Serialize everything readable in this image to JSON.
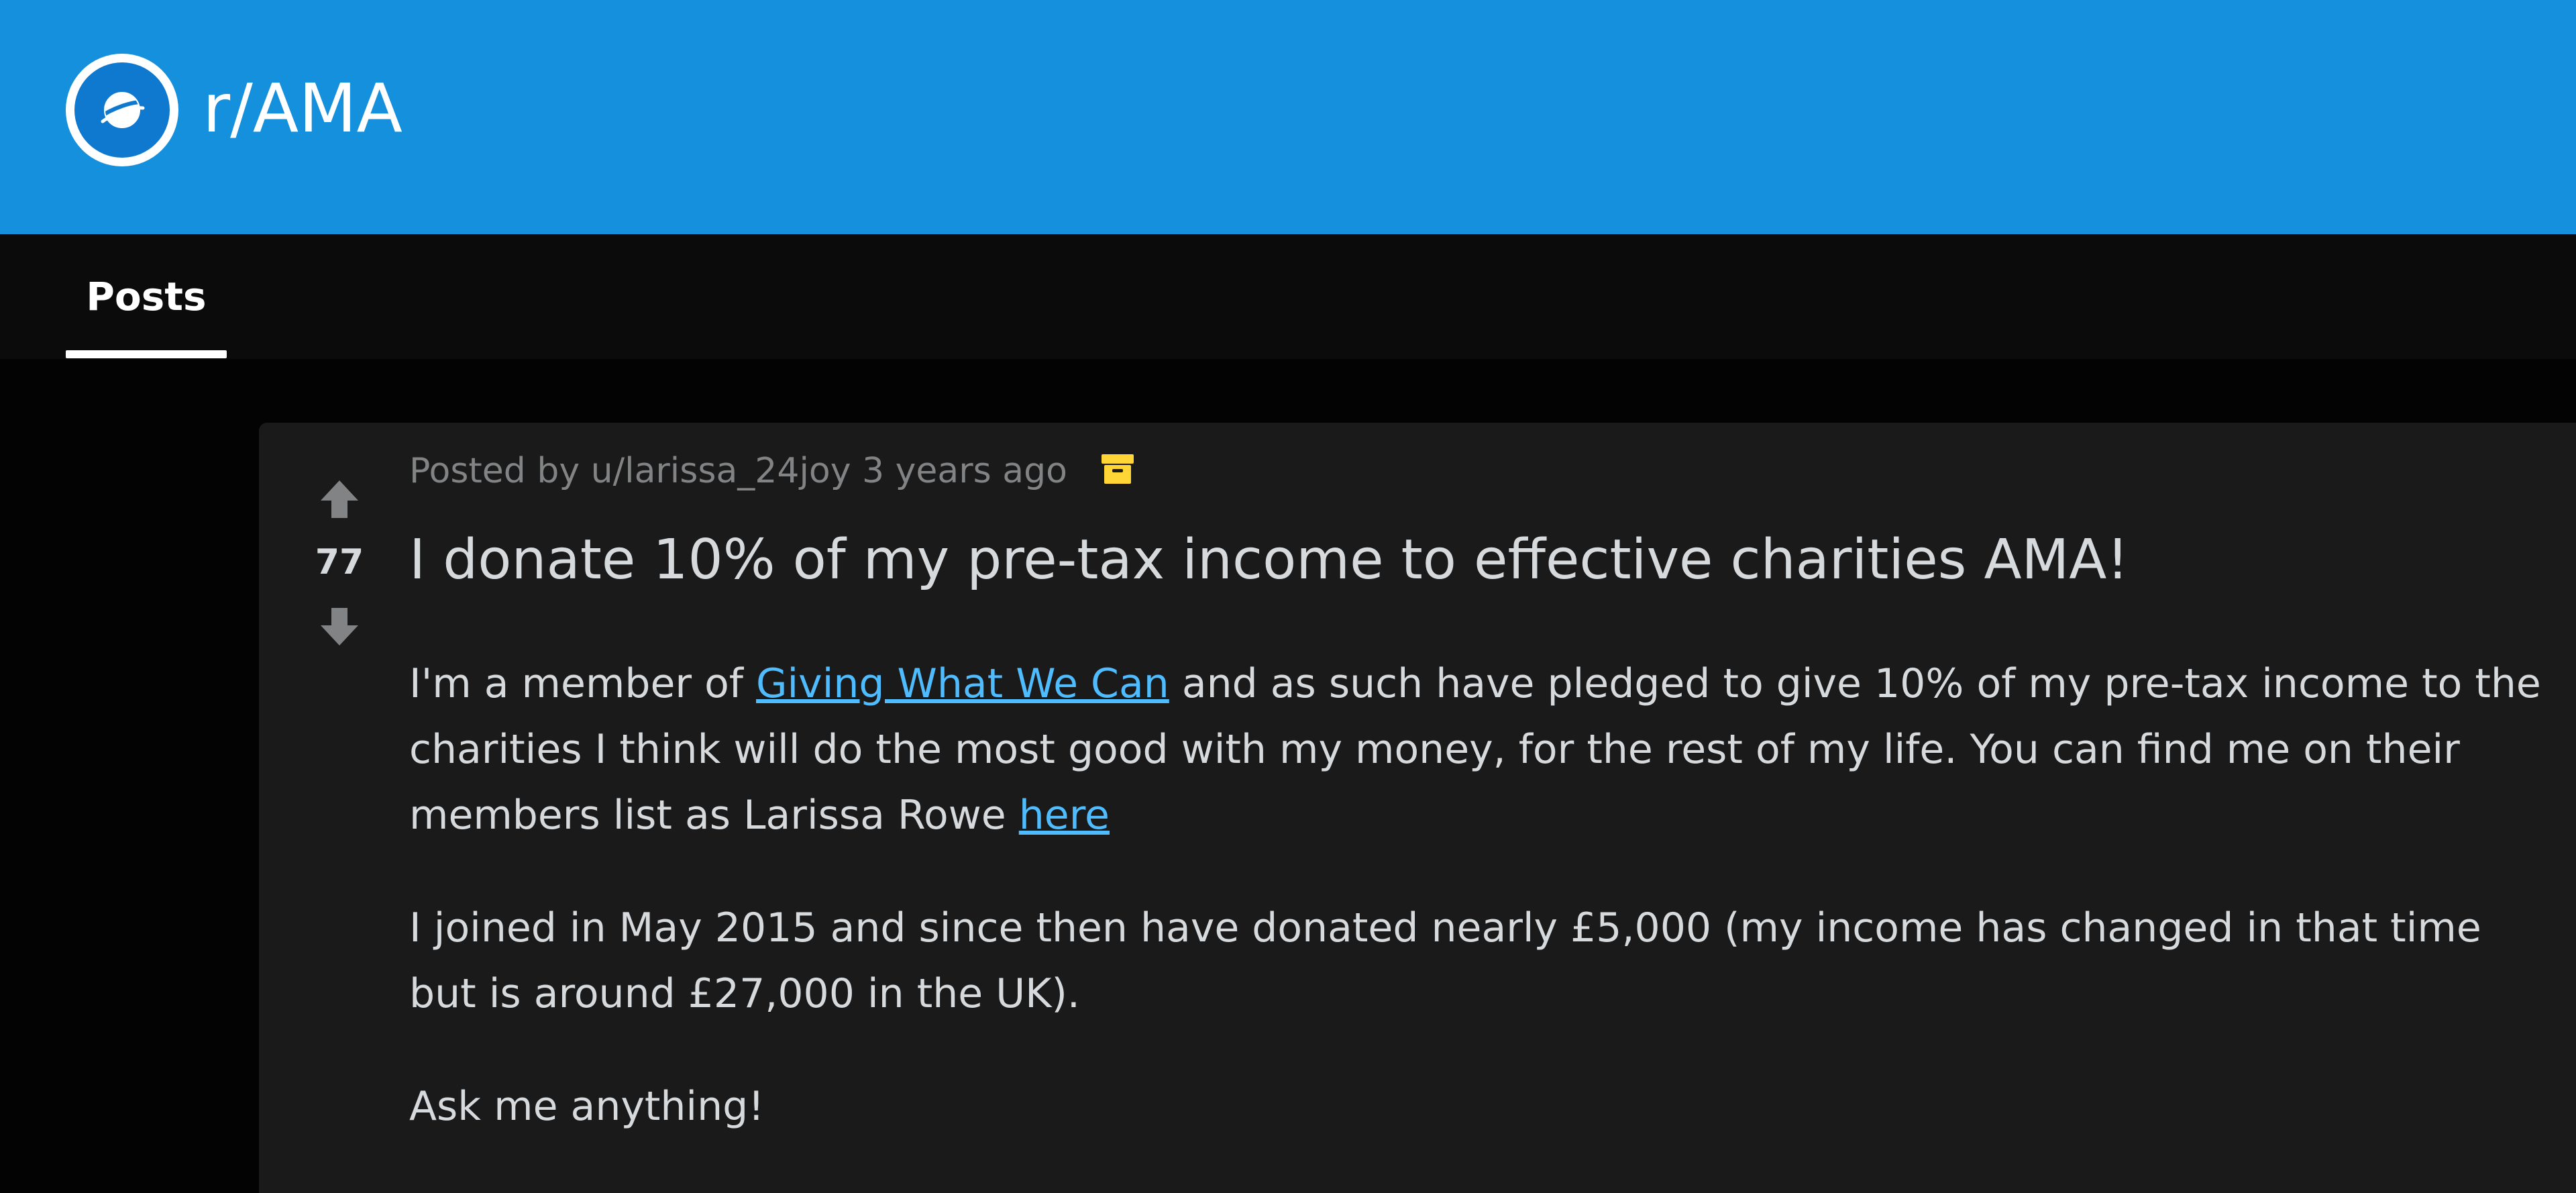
{
  "subreddit": {
    "name": "r/AMA",
    "icon": "planet-icon",
    "banner_color": "#1590dc"
  },
  "tabs": [
    {
      "label": "Posts",
      "active": true
    }
  ],
  "post": {
    "meta": {
      "posted_by_prefix": "Posted by",
      "author": "u/larissa_24joy",
      "time": "3 years ago",
      "archived_icon": "archive-box-icon"
    },
    "score": "77",
    "title": "I donate 10% of my pre-tax income to effective charities AMA!",
    "body": {
      "p1_before_link": "I'm a member of ",
      "p1_link_text": "Giving What We Can",
      "p1_after_link": " and as such have pledged to give 10% of my pre-tax income to the charities I think will do the most good with my money, for the rest of my life. You can find me on their members list as Larissa Rowe ",
      "p1_link2_text": "here",
      "p2": "I joined in May 2015 and since then have donated nearly £5,000 (my income has changed in that time but is around £27,000 in the UK).",
      "p3": "Ask me anything!"
    }
  },
  "colors": {
    "page_background": "#030303",
    "card_background": "#1a1a1b",
    "link": "#4fbcff",
    "text": "#d7dadc",
    "meta_text": "#818384",
    "archive_icon": "#ffd635"
  }
}
